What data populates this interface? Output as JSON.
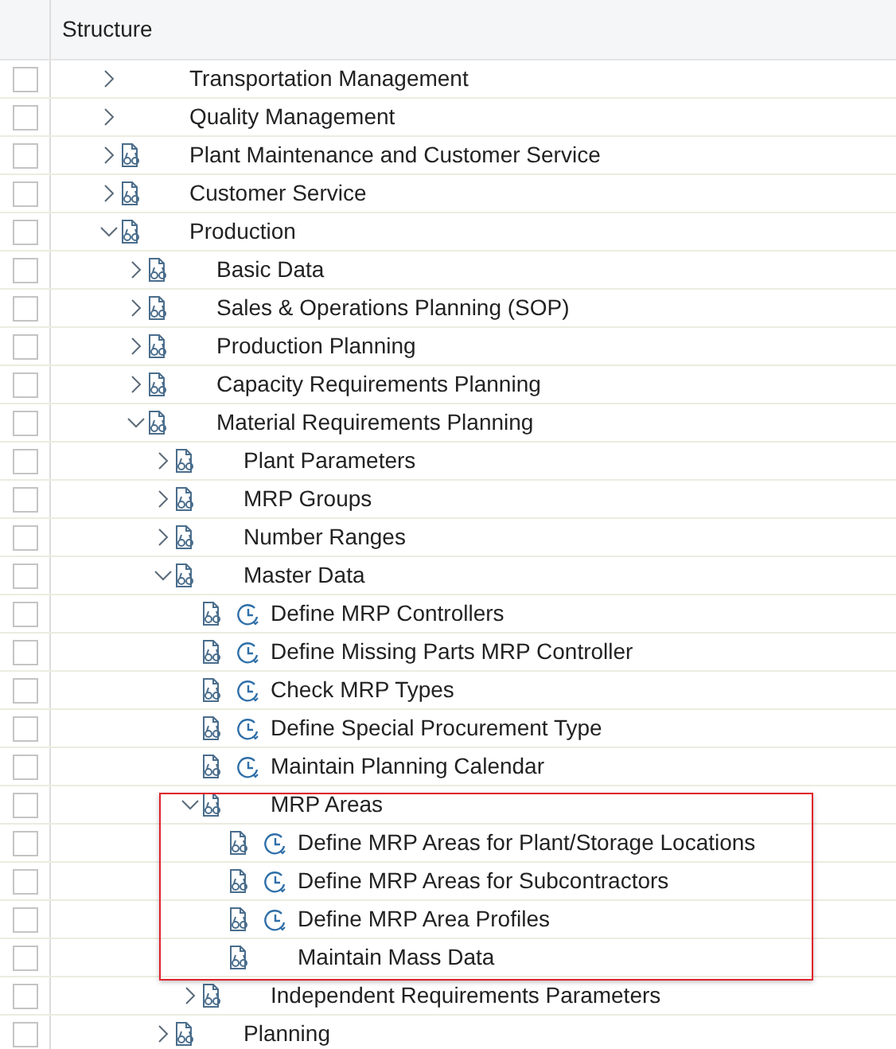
{
  "header": {
    "title": "Structure"
  },
  "tree": [
    {
      "label": "Transportation Management",
      "checked": false,
      "expanded": false
    },
    {
      "label": "Quality Management",
      "checked": false,
      "expanded": false
    },
    {
      "label": "Plant Maintenance and Customer Service",
      "checked": false,
      "expanded": false,
      "doc_icon": true
    },
    {
      "label": "Customer Service",
      "checked": false,
      "expanded": false,
      "doc_icon": true
    },
    {
      "label": "Production",
      "checked": false,
      "expanded": true,
      "doc_icon": true,
      "children": [
        {
          "label": "Basic Data",
          "checked": false,
          "expanded": false,
          "doc_icon": true
        },
        {
          "label": "Sales & Operations Planning (SOP)",
          "checked": false,
          "expanded": false,
          "doc_icon": true
        },
        {
          "label": "Production Planning",
          "checked": false,
          "expanded": false,
          "doc_icon": true
        },
        {
          "label": "Capacity Requirements Planning",
          "checked": false,
          "expanded": false,
          "doc_icon": true
        },
        {
          "label": "Material Requirements Planning",
          "checked": false,
          "expanded": true,
          "doc_icon": true,
          "children": [
            {
              "label": "Plant Parameters",
              "checked": false,
              "expanded": false,
              "doc_icon": true
            },
            {
              "label": "MRP Groups",
              "checked": false,
              "expanded": false,
              "doc_icon": true
            },
            {
              "label": "Number Ranges",
              "checked": false,
              "expanded": false,
              "doc_icon": true
            },
            {
              "label": "Master Data",
              "checked": false,
              "expanded": true,
              "doc_icon": true,
              "children": [
                {
                  "label": "Define MRP Controllers",
                  "checked": false,
                  "doc_icon": true,
                  "clock_icon": true
                },
                {
                  "label": "Define Missing Parts MRP Controller",
                  "checked": false,
                  "doc_icon": true,
                  "clock_icon": true
                },
                {
                  "label": "Check MRP Types",
                  "checked": false,
                  "doc_icon": true,
                  "clock_icon": true
                },
                {
                  "label": "Define Special Procurement Type",
                  "checked": false,
                  "doc_icon": true,
                  "clock_icon": true
                },
                {
                  "label": "Maintain Planning Calendar",
                  "checked": false,
                  "doc_icon": true,
                  "clock_icon": true
                },
                {
                  "label": "MRP Areas",
                  "checked": false,
                  "expanded": true,
                  "doc_icon": true,
                  "highlighted": true,
                  "children": [
                    {
                      "label": "Define MRP Areas for Plant/Storage Locations",
                      "checked": false,
                      "doc_icon": true,
                      "clock_icon": true
                    },
                    {
                      "label": "Define MRP Areas for Subcontractors",
                      "checked": false,
                      "doc_icon": true,
                      "clock_icon": true
                    },
                    {
                      "label": "Define MRP Area Profiles",
                      "checked": false,
                      "doc_icon": true,
                      "clock_icon": true
                    },
                    {
                      "label": "Maintain Mass Data",
                      "checked": false,
                      "doc_icon": true
                    }
                  ]
                },
                {
                  "label": "Independent Requirements Parameters",
                  "checked": false,
                  "expanded": false,
                  "doc_icon": true
                }
              ]
            },
            {
              "label": "Planning",
              "checked": false,
              "expanded": false,
              "doc_icon": true
            }
          ]
        }
      ]
    }
  ]
}
